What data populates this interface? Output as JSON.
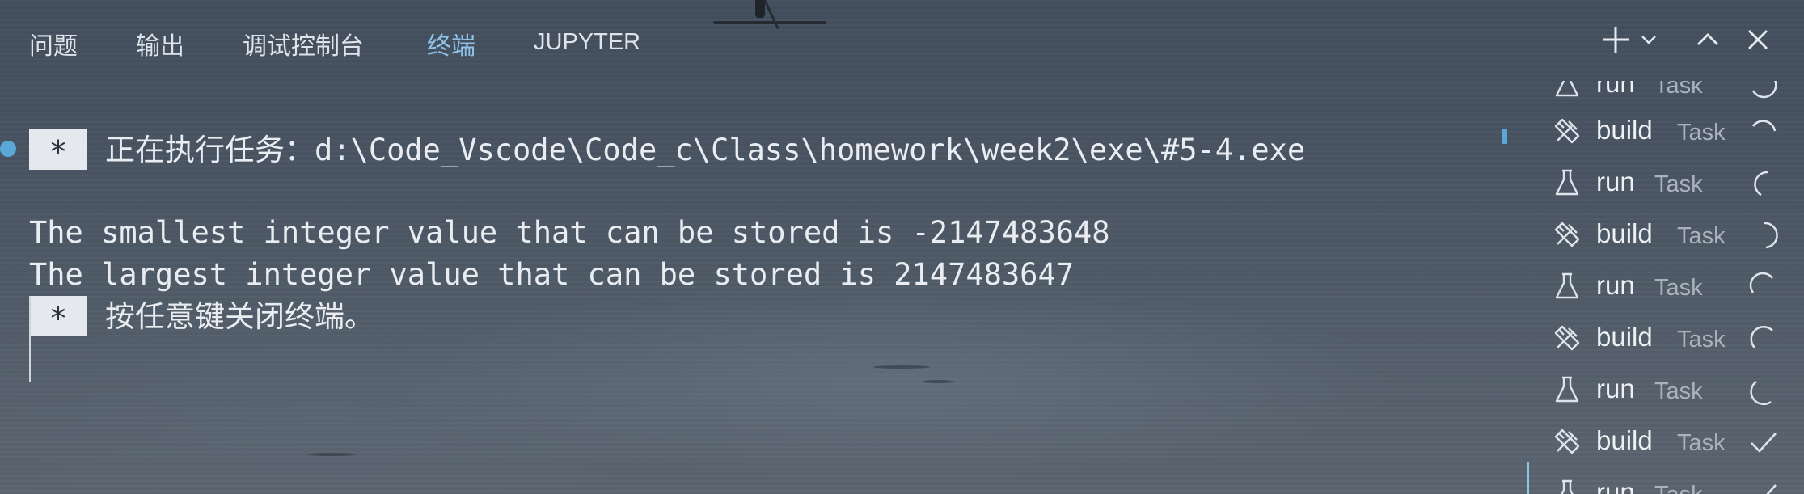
{
  "tabs": [
    {
      "label": "问题"
    },
    {
      "label": "输出"
    },
    {
      "label": "调试控制台"
    },
    {
      "label": "终端",
      "active": true
    },
    {
      "label": "JUPYTER"
    }
  ],
  "toolbar": {
    "icons": [
      "plus-icon",
      "chevron-down-icon",
      "chevron-up-icon",
      "close-icon"
    ]
  },
  "terminal": {
    "task_marker": "*",
    "running_message": "正在执行任务：",
    "running_path": "d:\\Code_Vscode\\Code_c\\Class\\homework\\week2\\exe\\#5-4.exe",
    "output_lines": [
      "The smallest integer value that can be stored is -2147483648",
      "The largest integer value that can be stored is 2147483647"
    ],
    "close_message": "按任意键关闭终端。"
  },
  "tasks": [
    {
      "name": "run",
      "kind": "Task",
      "status": "spinner"
    },
    {
      "name": "build",
      "kind": "Task",
      "status": "spinner"
    },
    {
      "name": "run",
      "kind": "Task",
      "status": "spinner"
    },
    {
      "name": "build",
      "kind": "Task",
      "status": "spinner"
    },
    {
      "name": "run",
      "kind": "Task",
      "status": "spinner"
    },
    {
      "name": "build",
      "kind": "Task",
      "status": "spinner"
    },
    {
      "name": "run",
      "kind": "Task",
      "status": "spinner"
    },
    {
      "name": "build",
      "kind": "Task",
      "status": "check"
    },
    {
      "name": "run",
      "kind": "Task",
      "status": "check",
      "selected": true
    }
  ],
  "colors": {
    "accent": "#8fc3e6",
    "text": "#e9ecf0",
    "muted": "#aab3bd"
  }
}
